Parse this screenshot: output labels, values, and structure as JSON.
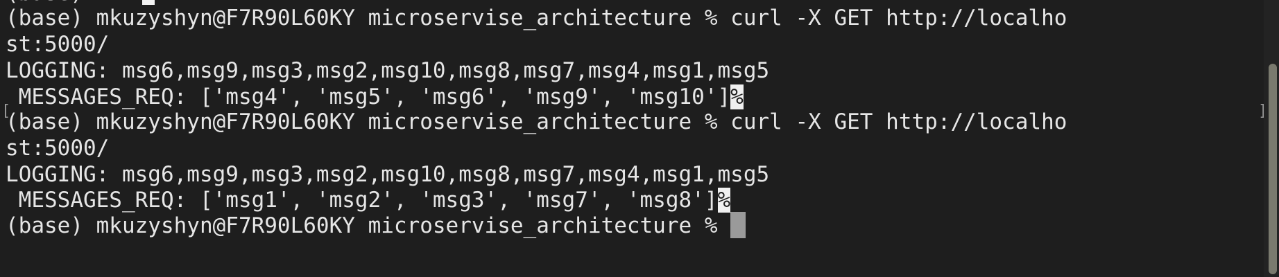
{
  "terminal": {
    "top_fragment": "(base)",
    "lines": [
      "(base) mkuzyshyn@F7R90L60KY microservise_architecture % curl -X GET http://localho",
      "st:5000/",
      "LOGGING: msg6,msg9,msg3,msg2,msg10,msg8,msg7,msg4,msg1,msg5",
      " MESSAGES_REQ: ['msg4', 'msg5', 'msg6', 'msg9', 'msg10']",
      "(base) mkuzyshyn@F7R90L60KY microservise_architecture % curl -X GET http://localho",
      "st:5000/",
      "LOGGING: msg6,msg9,msg3,msg2,msg10,msg8,msg7,msg4,msg1,msg5",
      " MESSAGES_REQ: ['msg1', 'msg2', 'msg3', 'msg7', 'msg8']",
      "(base) mkuzyshyn@F7R90L60KY microservise_architecture % "
    ],
    "eol_marker": "%",
    "left_bracket": "[",
    "right_bracket": "]"
  }
}
